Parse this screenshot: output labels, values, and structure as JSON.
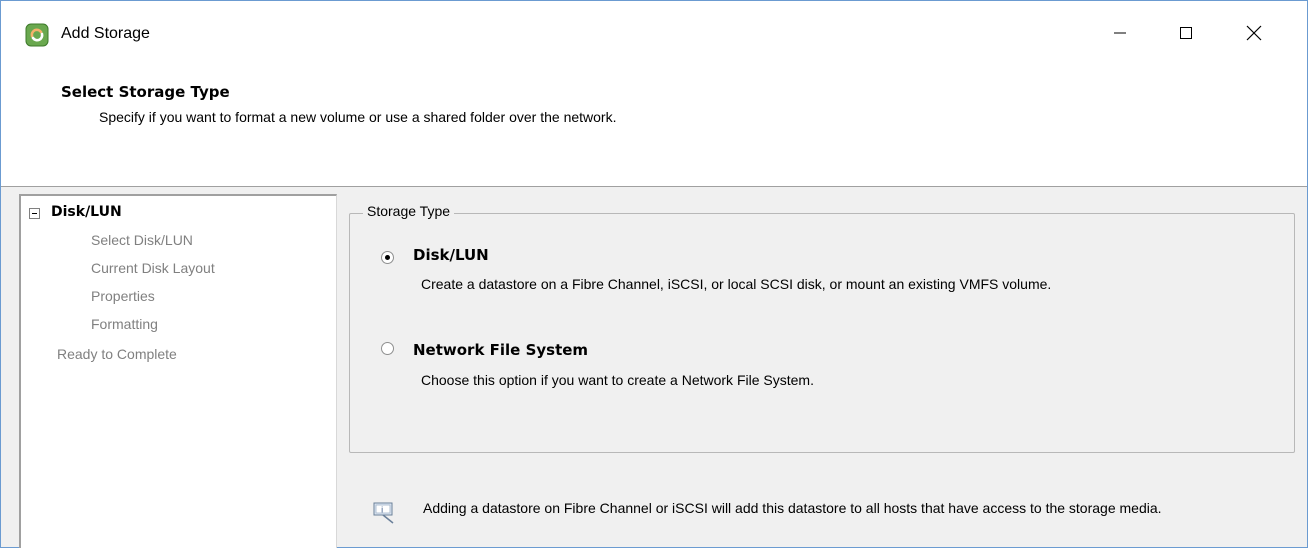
{
  "window": {
    "title": "Add Storage",
    "icon": "vsphere-add-storage-icon"
  },
  "controls": {
    "minimize_icon": "minimize-icon",
    "maximize_icon": "maximize-icon",
    "close_icon": "close-icon"
  },
  "header": {
    "title": "Select Storage Type",
    "subtitle": "Specify if you want to format a new volume or use a shared folder over the network."
  },
  "nav": {
    "root_label": "Disk/LUN",
    "items": [
      {
        "label": "Select Disk/LUN"
      },
      {
        "label": "Current Disk Layout"
      },
      {
        "label": "Properties"
      },
      {
        "label": "Formatting"
      }
    ],
    "ready_label": "Ready to Complete"
  },
  "storage_type": {
    "legend": "Storage Type",
    "options": [
      {
        "label": "Disk/LUN",
        "description": "Create a datastore on a Fibre Channel, iSCSI, or local SCSI disk, or mount an existing VMFS volume.",
        "selected": true
      },
      {
        "label": "Network File System",
        "description": "Choose this option if you want to create a Network File System.",
        "selected": false
      }
    ]
  },
  "info": {
    "icon": "info-icon",
    "text": "Adding a datastore on Fibre Channel or iSCSI will add this datastore to all hosts that have access to the storage media."
  }
}
